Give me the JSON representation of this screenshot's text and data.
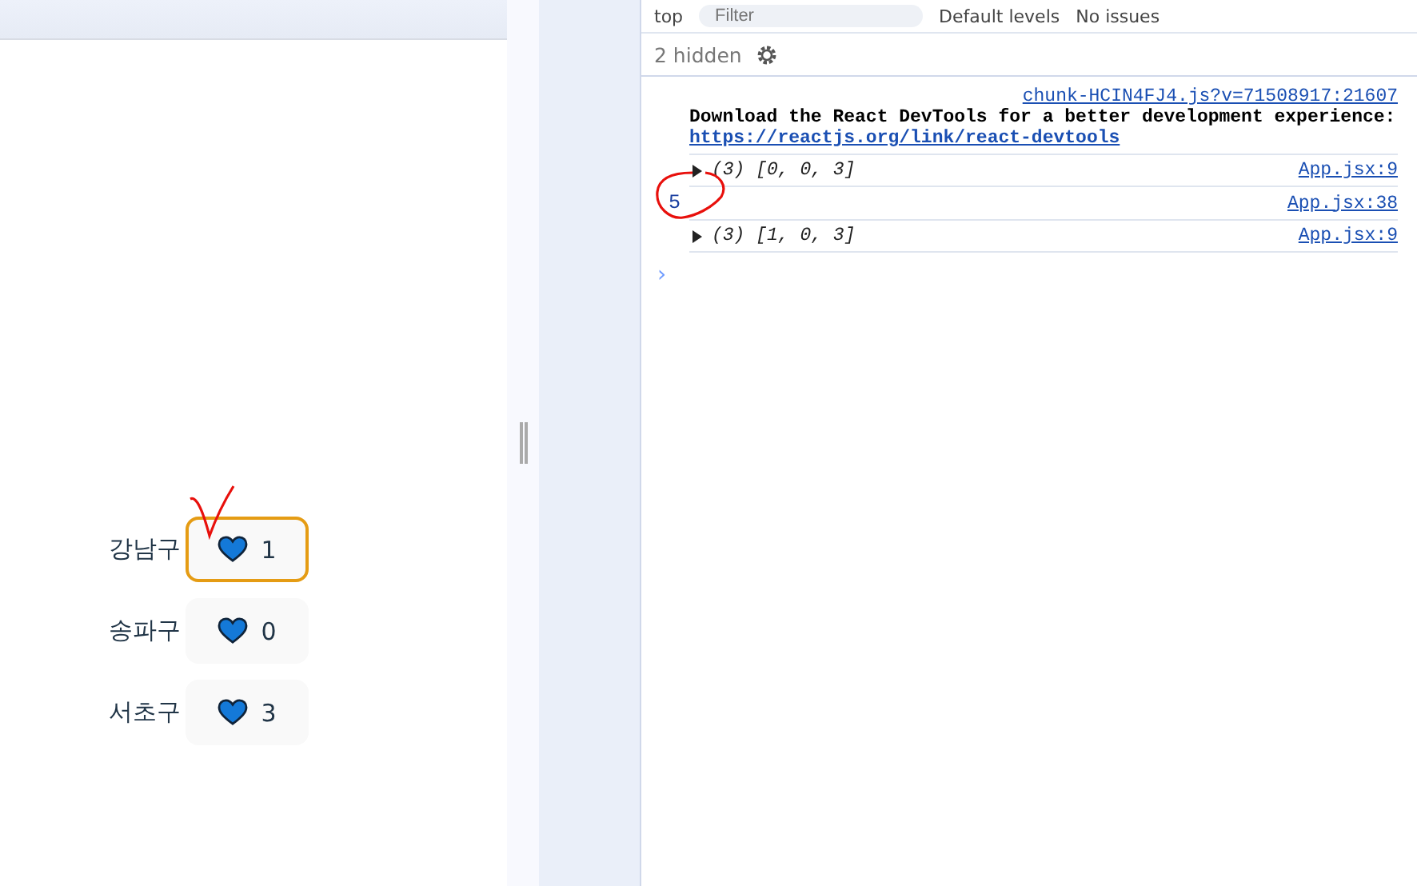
{
  "page": {
    "districts": [
      {
        "name": "강남구",
        "count": "1",
        "selected": true
      },
      {
        "name": "송파구",
        "count": "0",
        "selected": false
      },
      {
        "name": "서초구",
        "count": "3",
        "selected": false
      }
    ]
  },
  "devtools": {
    "toolbar": {
      "context": "top",
      "filter_placeholder": "Filter",
      "levels": "Default levels",
      "issues": "No issues"
    },
    "hidden": "2 hidden",
    "messages": [
      {
        "kind": "info",
        "source": "chunk-HCIN4FJ4.js?v=71508917:21607",
        "text": "Download the React DevTools for a better development experience:",
        "link": "https://reactjs.org/link/react-devtools"
      },
      {
        "kind": "array",
        "source": "App.jsx:9",
        "count": "(3)",
        "text": "[0, 0, 3]"
      },
      {
        "kind": "number",
        "source": "App.jsx:38",
        "text": "5"
      },
      {
        "kind": "array",
        "source": "App.jsx:9",
        "count": "(3)",
        "text": "[1, 0, 3]"
      }
    ],
    "prompt": "›"
  }
}
